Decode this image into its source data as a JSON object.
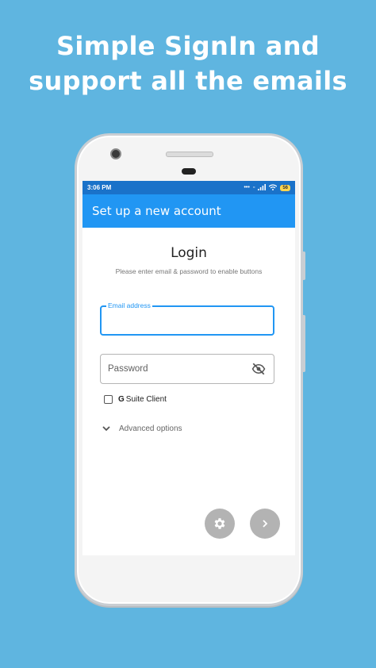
{
  "promo": {
    "line1": "Simple SignIn and",
    "line2": "support all the emails"
  },
  "statusbar": {
    "time": "3:06 PM",
    "battery": "56"
  },
  "appbar": {
    "title": "Set up a new account"
  },
  "login": {
    "title": "Login",
    "subtitle": "Please enter email & password to enable buttons",
    "email": {
      "label": "Email address",
      "value": ""
    },
    "password": {
      "placeholder": "Password",
      "value": ""
    },
    "gsuite": {
      "prefix": "G",
      "label": "Suite Client",
      "checked": false
    },
    "advanced_label": "Advanced options"
  },
  "icons": {
    "password_toggle": "eye-off-icon",
    "settings": "gear-icon",
    "next": "chevron-right-icon",
    "advanced": "chevron-down-icon"
  },
  "colors": {
    "background": "#5fb5e0",
    "statusbar": "#1a72c9",
    "appbar": "#2196f3",
    "accent": "#2196f3",
    "fab": "#b3b3b3"
  }
}
